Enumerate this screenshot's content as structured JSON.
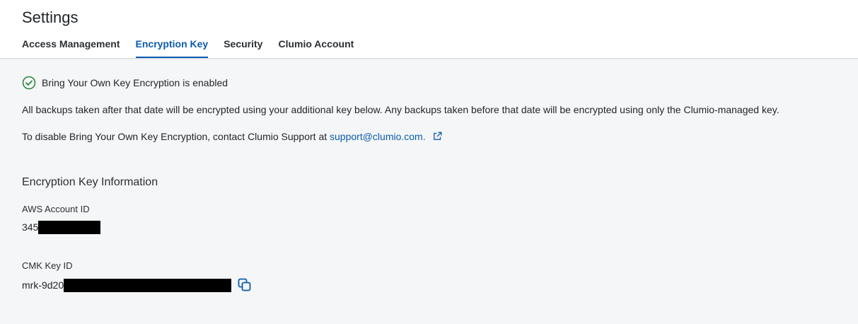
{
  "page": {
    "title": "Settings"
  },
  "tabs": [
    {
      "label": "Access Management",
      "active": false
    },
    {
      "label": "Encryption Key",
      "active": true
    },
    {
      "label": "Security",
      "active": false
    },
    {
      "label": "Clumio Account",
      "active": false
    }
  ],
  "status": {
    "icon": "check-circle-icon",
    "text": "Bring Your Own Key Encryption is enabled",
    "color": "#2e8540"
  },
  "info": {
    "backups_text": "All backups taken after that date will be encrypted using your additional key below. Any backups taken before that date will be encrypted using only the Clumio-managed key.",
    "disable_prefix": "To disable Bring Your Own Key Encryption, contact Clumio Support at ",
    "support_link": "support@clumio.com.",
    "external_icon": "external-link-icon"
  },
  "key_info": {
    "title": "Encryption Key Information",
    "aws_account_label": "AWS Account ID",
    "aws_account_value": "345",
    "cmk_label": "CMK Key ID",
    "cmk_value": "mrk-9d20",
    "copy_icon": "copy-icon"
  },
  "colors": {
    "accent": "#0b5cad",
    "background": "#f5f6f7",
    "header_bg": "#ffffff"
  }
}
